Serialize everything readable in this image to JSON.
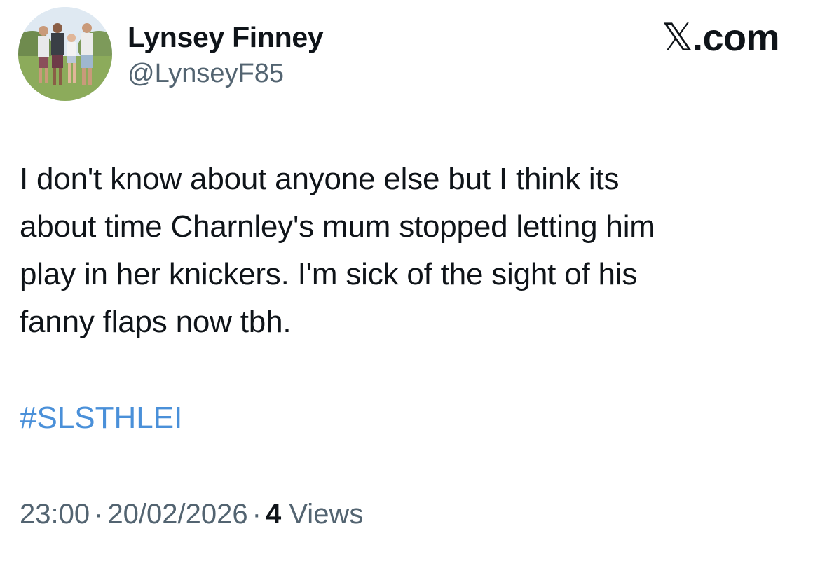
{
  "author": {
    "display_name": "Lynsey Finney",
    "handle": "@LynseyF85",
    "avatar_icon": "profile-photo-group"
  },
  "brand": {
    "label": ".com",
    "mark": "𝕏"
  },
  "tweet": {
    "lines": [
      "I don't know about anyone else but I think its",
      "about time Charnley's mum stopped letting him",
      "play in her knickers. I'm sick of the sight of his",
      "fanny flaps now tbh."
    ],
    "hashtag": "#SLSTHLEI"
  },
  "meta": {
    "time": "23:00",
    "date": "20/02/2026",
    "separator": "·",
    "views_count": "4",
    "views_label": "Views"
  },
  "colors": {
    "text": "#0f1419",
    "secondary": "#536471",
    "hashtag": "#4a90d9",
    "background": "#ffffff"
  }
}
